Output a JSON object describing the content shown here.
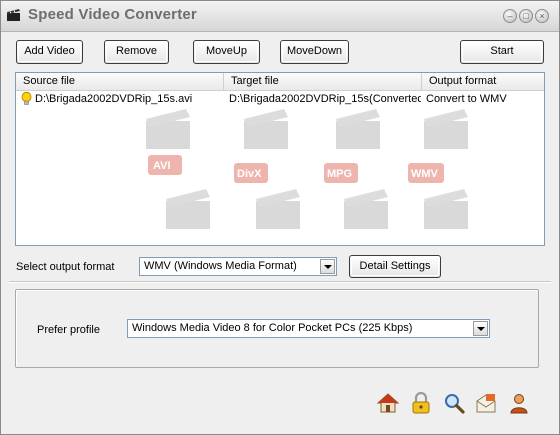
{
  "window": {
    "title": "Speed Video Converter"
  },
  "toolbar": {
    "add_video": "Add Video",
    "remove": "Remove",
    "move_up": "MoveUp",
    "move_down": "MoveDown",
    "start": "Start"
  },
  "file_list": {
    "columns": [
      "Source file",
      "Target file",
      "Output format"
    ],
    "rows": [
      {
        "source": "D:\\Brigada2002DVDRip_15s.avi",
        "target": "D:\\Brigada2002DVDRip_15s(Converted)....",
        "format": "Convert to WMV"
      }
    ]
  },
  "watermark": {
    "labels": [
      "AVI",
      "DivX",
      "MPG",
      "WMV"
    ]
  },
  "output_format": {
    "label": "Select output format",
    "selected": "WMV (Windows Media Format)",
    "detail_button": "Detail Settings"
  },
  "profile": {
    "label": "Prefer profile",
    "selected": "Windows Media Video 8 for Color Pocket PCs (225 Kbps)"
  },
  "bottom_icons": [
    "home-icon",
    "lock-icon",
    "magnifier-icon",
    "mail-icon",
    "user-icon"
  ],
  "colors": {
    "window_bg": "#efefef",
    "list_border": "#7f9db9",
    "watermark_red": "#d12d1e"
  }
}
